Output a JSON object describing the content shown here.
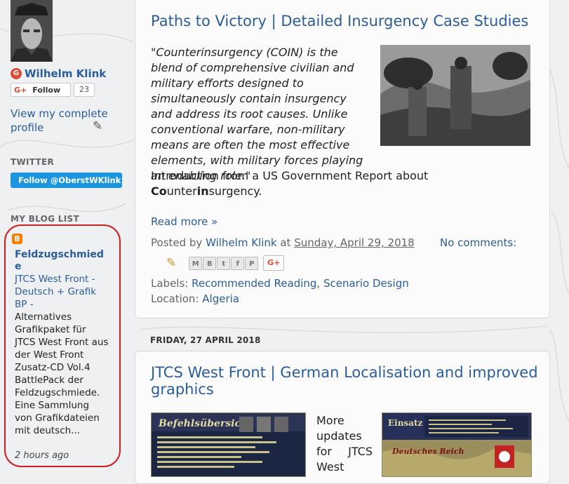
{
  "sidebar": {
    "profile_name": "Wilhelm Klink",
    "follow_label": "Follow",
    "follow_count": "23",
    "view_profile": "View my complete profile",
    "twitter_title": "TWITTER",
    "twitter_button": "Follow @OberstWKlink",
    "blog_list_title": "MY BLOG LIST",
    "blog": {
      "name": "Feldzugschmiede",
      "post_title": "JTCS West Front - Deutsch + Grafik BP -",
      "snippet": "Alternatives Grafikpaket für JTCS West Front aus der West Front Zusatz-CD Vol.4 BattlePack der Feldzugschmiede. Eine Sammlung von Grafikdateien mit deutsch...",
      "time": "2 hours ago"
    }
  },
  "post1": {
    "title": "Paths to Victory | Detailed Insurgency Case Studies",
    "quote": "\"Counterinsurgency (COIN) is the blend of comprehensive civilian and military efforts designed to simultaneously contain insurgency and address its root causes. Unlike conventional warfare, non-military means are often the most effective elements, with military forces playing an enabling role.\"",
    "intro_text": " Introduction from a US Government Report about ",
    "acronym": {
      "p1": "Co",
      "p2": "unter",
      "p3": "in",
      "p4": "surgency."
    },
    "read_more": "Read more »",
    "posted_by": "Posted by",
    "author": "Wilhelm Klink",
    "at": "at",
    "date": "Sunday, April 29, 2018",
    "comments": "No comments:",
    "labels_label": "Labels:",
    "labels": [
      "Recommended Reading",
      "Scenario Design"
    ],
    "location_label": "Location:",
    "location": "Algeria",
    "share_icons": [
      "M",
      "B",
      "t",
      "f",
      "P"
    ],
    "gplus": "G+"
  },
  "date_header": "FRIDAY, 27 APRIL 2018",
  "post2": {
    "title": "JTCS West Front | German Localisation and improved graphics",
    "text": "More updates for JTCS West",
    "thumb1_title": "Befehlsübersicht",
    "thumb2_title": "Einsatz",
    "thumb2_map": "Deutsches Reich"
  },
  "colors": {
    "link": "#2a5d9a",
    "twitter": "#1b95e0",
    "gplus": "#dd4b39",
    "highlight_circle": "#cc1f1f",
    "blogger": "#f57d00"
  }
}
